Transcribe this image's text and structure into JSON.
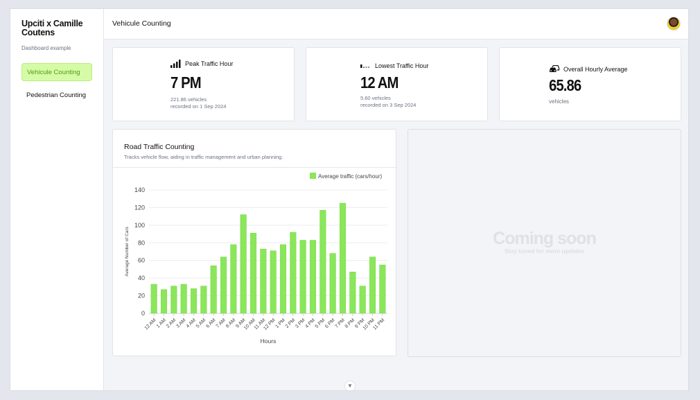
{
  "sidebar": {
    "brand": "Upciti x Camille Coutens",
    "subtitle": "Dashboard example",
    "items": [
      {
        "label": "Vehicule Counting",
        "active": true
      },
      {
        "label": "Pedestrian Counting",
        "active": false
      }
    ]
  },
  "header": {
    "title": "Vehicule Counting"
  },
  "kpis": {
    "peak": {
      "label": "Peak Traffic Hour",
      "value": "7 PM",
      "line1": "221.86 vehicles",
      "line2": "recorded on 1 Sep 2024",
      "icon": "signal-bars-icon"
    },
    "lowest": {
      "label": "Lowest Traffic Hour",
      "value": "12 AM",
      "line1": "5.60 vehicles",
      "line2": "recorded on 3 Sep 2024",
      "icon": "signal-low-icon"
    },
    "average": {
      "label": "Overall Hourly Average",
      "value": "65.86",
      "line1": "vehicles",
      "icon": "cars-icon"
    }
  },
  "chart_card": {
    "title": "Road Traffic Counting",
    "subtitle": "Tracks vehicle flow, aiding in traffic management and urban planning."
  },
  "placeholder": {
    "title": "Coming soon",
    "subtitle": "Stay tuned for more updates"
  },
  "colors": {
    "accent": "#8ae65a",
    "nav_active_bg": "#d6fba6",
    "nav_active_text": "#4f9b11"
  },
  "chart_data": {
    "type": "bar",
    "categories": [
      "12 AM",
      "1 AM",
      "2 AM",
      "3 AM",
      "4 AM",
      "5 AM",
      "6 AM",
      "7 AM",
      "8 AM",
      "9 AM",
      "10 AM",
      "11 AM",
      "12 PM",
      "1 PM",
      "2 PM",
      "3 PM",
      "4 PM",
      "5 PM",
      "6 PM",
      "7 PM",
      "8 PM",
      "9 PM",
      "10 PM",
      "11 PM"
    ],
    "series": [
      {
        "name": "Average traffic (cars/hour)",
        "values": [
          33,
          27,
          31,
          33,
          28,
          31,
          54,
          64,
          78,
          112,
          91,
          73,
          71,
          78,
          92,
          83,
          83,
          117,
          68,
          125,
          47,
          31,
          64,
          55
        ]
      }
    ],
    "xlabel": "Hours",
    "ylabel": "Average Number of Cars",
    "ylim": [
      0,
      140
    ],
    "yticks": [
      0,
      20,
      40,
      60,
      80,
      100,
      120,
      140
    ],
    "grid": true,
    "legend": "top-right"
  }
}
